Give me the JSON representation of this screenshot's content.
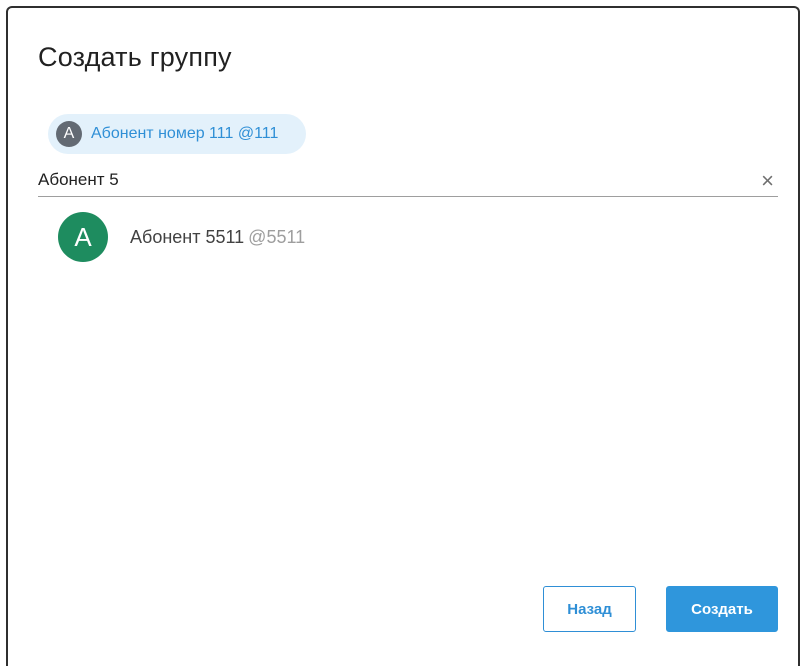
{
  "dialog": {
    "title": "Создать группу"
  },
  "selected_chip": {
    "avatar_letter": "A",
    "label": "Абонент номер 111 @111"
  },
  "search": {
    "value": "Абонент 5",
    "clear_icon": "×"
  },
  "results": [
    {
      "avatar_letter": "A",
      "name": "Абонент 5511",
      "handle": "@5511"
    }
  ],
  "buttons": {
    "back_label": "Назад",
    "create_label": "Создать"
  },
  "colors": {
    "accent": "#2f96dc",
    "chip_background": "#e3f1fb",
    "chip_avatar": "#636a73",
    "result_avatar": "#1e8c5f"
  },
  "icons": {
    "clear": "close-icon"
  }
}
